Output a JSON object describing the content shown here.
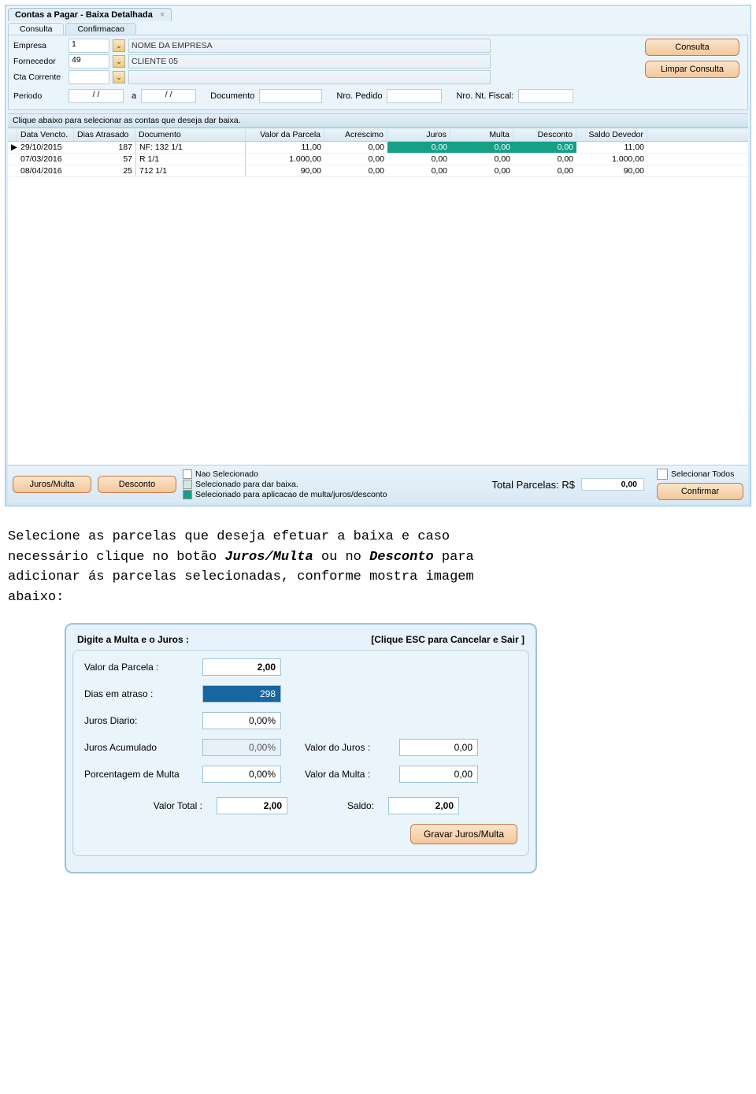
{
  "window": {
    "title": "Contas a Pagar - Baixa Detalhada"
  },
  "subtabs": {
    "consulta": "Consulta",
    "confirmacao": "Confirmacao"
  },
  "form": {
    "empresa_label": "Empresa",
    "empresa_code": "1",
    "empresa_name": "NOME DA EMPRESA",
    "fornecedor_label": "Fornecedor",
    "fornecedor_code": "49",
    "fornecedor_name": "CLIENTE 05",
    "cta_label": "Cta Corrente",
    "cta_code": "",
    "cta_name": "",
    "periodo_label": "Periodo",
    "periodo_from": "/  /",
    "periodo_a": "a",
    "periodo_to": "/  /",
    "documento_label": "Documento",
    "documento": "",
    "nro_pedido_label": "Nro. Pedido",
    "nro_pedido": "",
    "nro_nt_label": "Nro. Nt. Fiscal:",
    "nro_nt": ""
  },
  "buttons": {
    "consulta": "Consulta",
    "limpar": "Limpar Consulta",
    "juros_multa": "Juros/Multa",
    "desconto": "Desconto",
    "selecionar_todos": "Selecionar Todos",
    "confirmar": "Confirmar"
  },
  "hint": "Clique abaixo para selecionar as contas que deseja dar baixa.",
  "grid": {
    "headers": {
      "data": "Data Vencto.",
      "dias": "Dias Atrasado",
      "documento": "Documento",
      "valor": "Valor da Parcela",
      "acrescimo": "Acrescimo",
      "juros": "Juros",
      "multa": "Multa",
      "desconto": "Desconto",
      "saldo": "Saldo Devedor"
    },
    "rows": [
      {
        "mark": "▶",
        "data": "29/10/2015",
        "dias": "187",
        "doc": "NF: 132 1/1",
        "valor": "11,00",
        "acr": "0,00",
        "jur": "0,00",
        "mul": "0,00",
        "desc": "0,00",
        "saldo": "11,00",
        "selected": true
      },
      {
        "mark": "",
        "data": "07/03/2016",
        "dias": "57",
        "doc": "R 1/1",
        "valor": "1.000,00",
        "acr": "0,00",
        "jur": "0,00",
        "mul": "0,00",
        "desc": "0,00",
        "saldo": "1.000,00",
        "selected": false
      },
      {
        "mark": "",
        "data": "08/04/2016",
        "dias": "25",
        "doc": "712 1/1",
        "valor": "90,00",
        "acr": "0,00",
        "jur": "0,00",
        "mul": "0,00",
        "desc": "0,00",
        "saldo": "90,00",
        "selected": false
      }
    ]
  },
  "legend": {
    "nao": "Nao Selecionado",
    "dar": "Selecionado para dar baixa.",
    "aplic": "Selecionado para aplicacao de multa/juros/desconto"
  },
  "totals": {
    "label": "Total Parcelas:  R$",
    "value": "0,00"
  },
  "instruction": {
    "line1a": "Selecione as parcelas que deseja efetuar a baixa e caso",
    "line2a": "necessário clique no botão ",
    "jm": "Juros/Multa",
    "line2b": " ou no ",
    "desc": "Desconto",
    "line2c": " para",
    "line3": "adicionar ás parcelas selecionadas, conforme mostra imagem",
    "line4": "abaixo:"
  },
  "dialog": {
    "title": "Digite a Multa e o Juros :",
    "esc": "[Clique ESC para Cancelar e Sair ]",
    "valor_parcela_label": "Valor da Parcela :",
    "valor_parcela": "2,00",
    "dias_atraso_label": "Dias em atraso :",
    "dias_atraso": "298",
    "juros_diario_label": "Juros  Diario:",
    "juros_diario": "0,00%",
    "juros_acum_label": "Juros Acumulado",
    "juros_acum": "0,00%",
    "valor_juros_label": "Valor do Juros :",
    "valor_juros": "0,00",
    "porc_multa_label": "Porcentagem de Multa",
    "porc_multa": "0,00%",
    "valor_multa_label": "Valor da Multa :",
    "valor_multa": "0,00",
    "valor_total_label": "Valor Total :",
    "valor_total": "2,00",
    "saldo_label": "Saldo:",
    "saldo": "2,00",
    "gravar": "Gravar Juros/Multa"
  }
}
